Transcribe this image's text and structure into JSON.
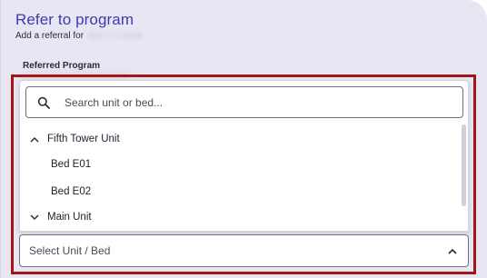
{
  "header": {
    "title": "Refer to program",
    "subtitle": "Add a referral for"
  },
  "field": {
    "label": "Referred Program"
  },
  "search": {
    "placeholder": "Search unit or bed..."
  },
  "groups": [
    {
      "label": "Fifth Tower Unit",
      "expanded": true,
      "items": [
        "Bed E01",
        "Bed E02"
      ]
    },
    {
      "label": "Main Unit",
      "expanded": true,
      "items": []
    }
  ],
  "select": {
    "placeholder": "Select Unit / Bed"
  },
  "colors": {
    "title": "#3d3bb0",
    "highlight": "#a51616",
    "background": "#e7e6f2"
  },
  "icons": {
    "search": "search-icon",
    "expand": "chevron-up-icon",
    "collapse": "chevron-down-icon"
  }
}
